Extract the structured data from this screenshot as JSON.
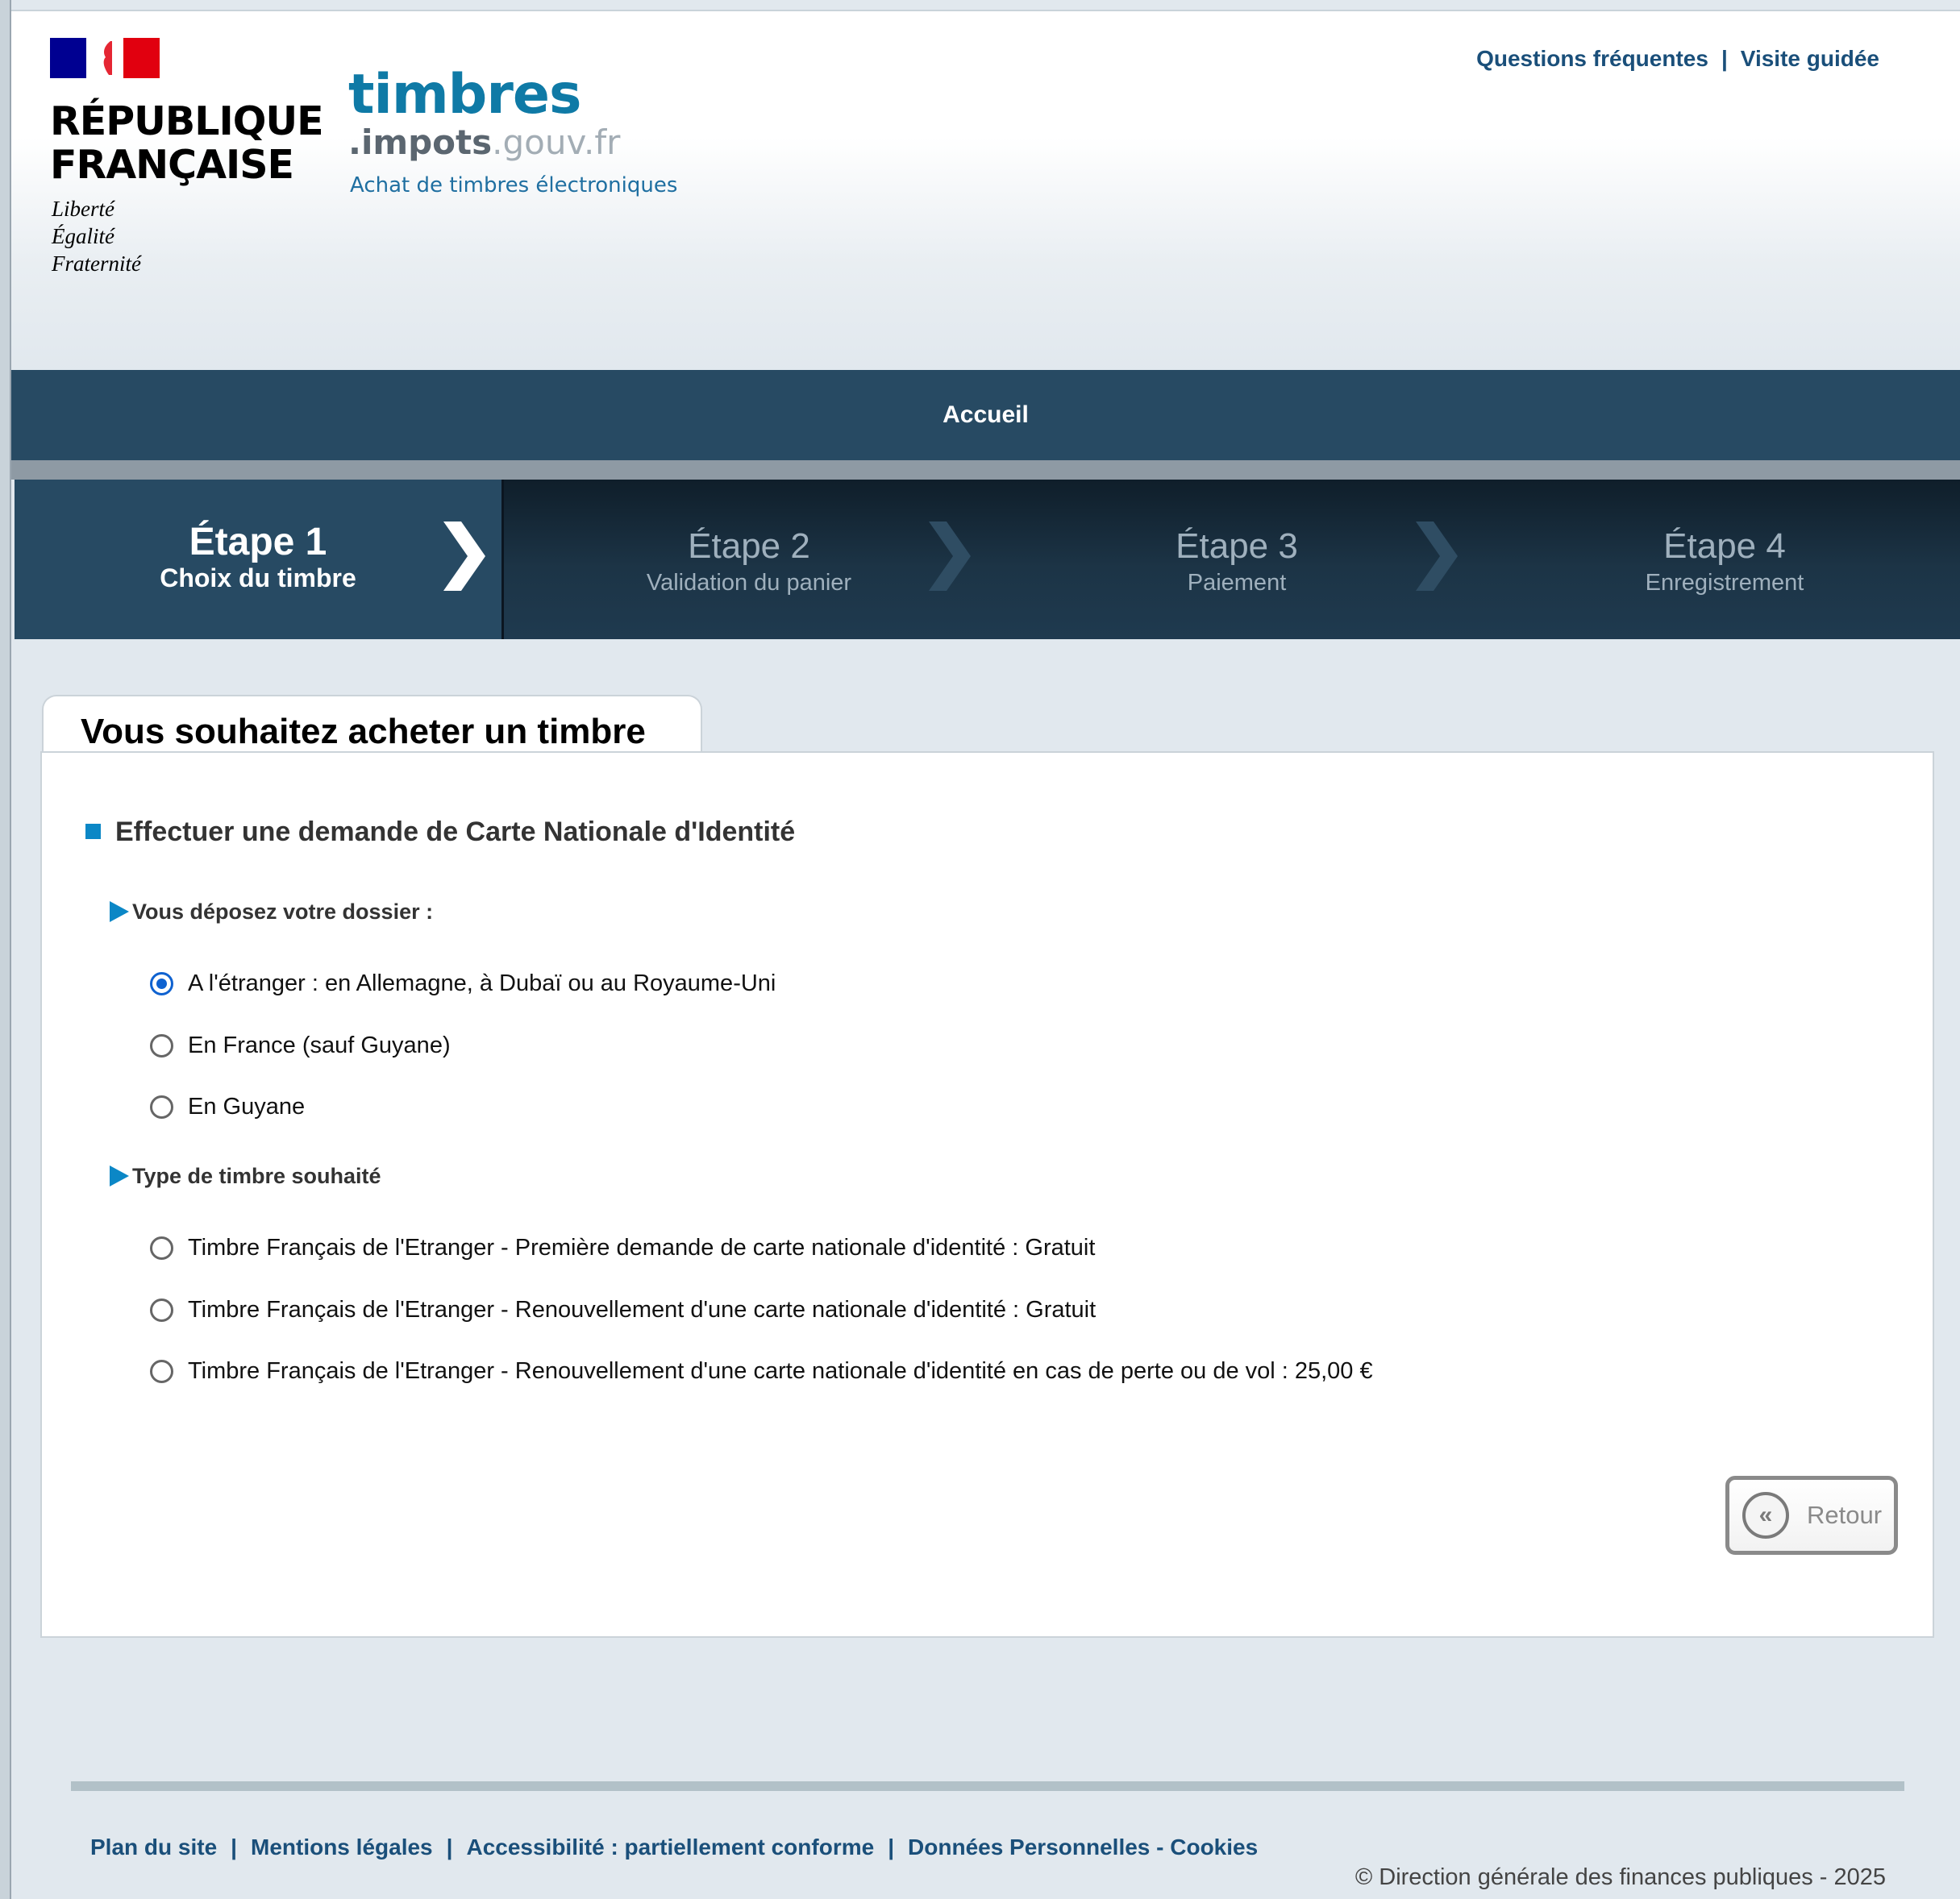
{
  "header": {
    "republic_name_line1": "RÉPUBLIQUE",
    "republic_name_line2": "FRANÇAISE",
    "motto": [
      "Liberté",
      "Égalité",
      "Fraternité"
    ],
    "brand_name": "timbres",
    "brand_domain_part1": ".impots",
    "brand_domain_part2": ".gouv.fr",
    "brand_subtitle": "Achat de timbres électroniques",
    "links": [
      {
        "label": "Questions fréquentes"
      },
      {
        "label": "Visite guidée"
      }
    ],
    "link_separator": "|",
    "colors": {
      "flag_blue": "#000091",
      "flag_red": "#e1000f",
      "brand": "#0f7aa6"
    }
  },
  "nav": {
    "home_label": "Accueil"
  },
  "steps": [
    {
      "title": "Étape 1",
      "subtitle": "Choix du timbre",
      "active": true
    },
    {
      "title": "Étape 2",
      "subtitle": "Validation du panier",
      "active": false
    },
    {
      "title": "Étape 3",
      "subtitle": "Paiement",
      "active": false
    },
    {
      "title": "Étape 4",
      "subtitle": "Enregistrement",
      "active": false
    }
  ],
  "main": {
    "tab_title": "Vous souhaitez acheter un timbre",
    "section_title": "Effectuer une demande de Carte Nationale d'Identité",
    "deposit": {
      "heading": "Vous déposez votre dossier :",
      "options": [
        {
          "label": "A l'étranger : en Allemagne, à Dubaï ou au Royaume-Uni",
          "checked": true
        },
        {
          "label": "En France (sauf Guyane)",
          "checked": false
        },
        {
          "label": "En Guyane",
          "checked": false
        }
      ]
    },
    "stamp_type": {
      "heading": "Type de timbre souhaité",
      "options": [
        {
          "label": "Timbre Français de l'Etranger - Première demande de carte nationale d'identité : Gratuit",
          "checked": false
        },
        {
          "label": "Timbre Français de l'Etranger - Renouvellement d'une carte nationale d'identité : Gratuit",
          "checked": false
        },
        {
          "label": "Timbre Français de l'Etranger - Renouvellement d'une carte nationale d'identité en cas de perte ou de vol : 25,00 €",
          "checked": false
        }
      ]
    },
    "back_button": {
      "icon": "«",
      "label": "Retour"
    }
  },
  "footer": {
    "links": [
      {
        "label": "Plan du site"
      },
      {
        "label": "Mentions légales"
      },
      {
        "label": "Accessibilité : partiellement conforme"
      },
      {
        "label": "Données Personnelles - Cookies"
      }
    ],
    "link_separator": "|",
    "copyright": "© Direction générale des finances publiques - 2025"
  }
}
